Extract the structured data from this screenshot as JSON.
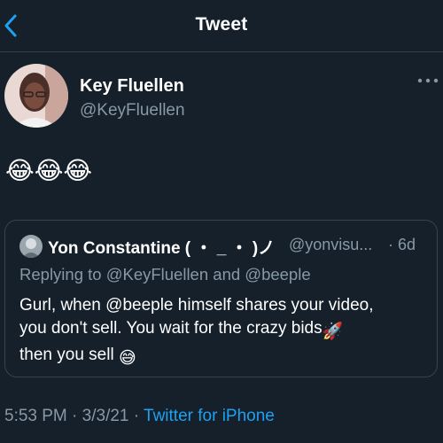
{
  "header": {
    "title": "Tweet",
    "back_icon": "chevron-left-icon",
    "accent_color": "#1da1f2"
  },
  "tweet": {
    "author_name": "Key Fluellen",
    "author_handle": "@KeyFluellen",
    "text": "😂😂😂",
    "more_icon": "ellipsis-icon"
  },
  "quoted_tweet": {
    "author_name": "Yon Constantine ( ・ _ ・ )ノ",
    "author_handle": "@yonvisu...",
    "time": "· 6d",
    "reply_context": "Replying to @KeyFluellen and @beeple",
    "body_lines": [
      "Gurl, when @beeple himself shares your video,",
      "you don't sell. You wait for the crazy bids",
      "then you sell"
    ],
    "rocket_emoji": "🚀",
    "sweat_emoji": "😅"
  },
  "meta": {
    "time": "5:53 PM",
    "separator": "·",
    "date": "3/3/21",
    "source": "Twitter for iPhone"
  },
  "colors": {
    "background": "#15202b",
    "secondary_text": "#8899a6",
    "link": "#1da1f2",
    "border": "#38444d"
  }
}
